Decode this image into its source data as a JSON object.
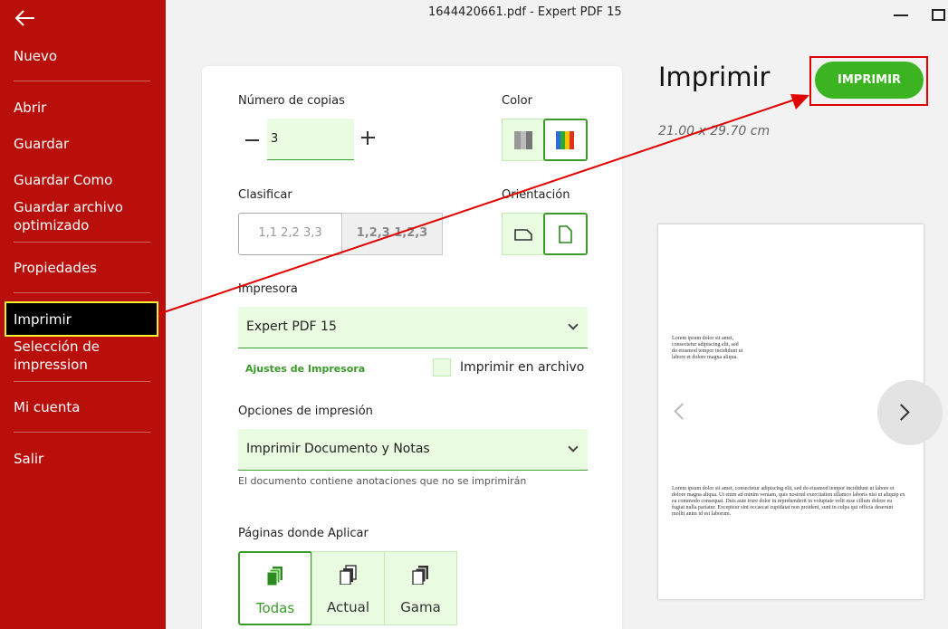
{
  "window": {
    "title": "1644420661.pdf   -   Expert PDF 15"
  },
  "sidebar": {
    "items": [
      {
        "label": "Nuevo"
      },
      {
        "label": "Abrir"
      },
      {
        "label": "Guardar"
      },
      {
        "label": "Guardar Como"
      },
      {
        "label": "Guardar archivo optimizado"
      },
      {
        "label": "Propiedades"
      },
      {
        "label": "Imprimir"
      },
      {
        "label": "Selección de impression"
      },
      {
        "label": "Mi cuenta"
      },
      {
        "label": "Salir"
      }
    ],
    "active": "Imprimir"
  },
  "print": {
    "copies_label": "Número de copias",
    "copies_value": "3",
    "color_label": "Color",
    "collate_label": "Clasificar",
    "collate_options": [
      "1,1 2,2 3,3",
      "1,2,3 1,2,3"
    ],
    "orientation_label": "Orientación",
    "printer_label": "Impresora",
    "printer_value": "Expert PDF 15",
    "printer_settings_link": "Ajustes de Impresora",
    "print_to_file_label": "Imprimir en archivo",
    "options_label": "Opciones de impresión",
    "options_value": "Imprimir Documento y Notas",
    "annotations_note": "El documento contiene anotaciones que no se imprimirán",
    "pages_label": "Páginas donde Aplicar",
    "pages_options": [
      "Todas",
      "Actual",
      "Gama"
    ]
  },
  "preview": {
    "heading": "Imprimir",
    "button_label": "IMPRIMIR",
    "page_size": "21.00 x 29.70 cm",
    "lorem_short": "Lorem ipsum dolor sit amet, consectetur adipiscing elit, sed do eiusmod tempor incididunt ut labore et dolore magna aliqua.",
    "lorem_long": "Lorem ipsum dolor sit amet, consectetur adipiscing elit, sed do eiusmod tempor incididunt ut labore et dolore magna aliqua. Ut enim ad minim veniam, quis nostrud exercitation ullamco laboris nisi ut aliquip ex ea commodo consequat. Duis aute irure dolor in reprehenderit in voluptate velit esse cillum dolore eu fugiat nulla pariatur. Excepteur sint occaecat cupidatat non proident, sunt in culpa qui officia deserunt mollit anim id est laborum."
  },
  "colors": {
    "sidebar": "#b80f0a",
    "accent": "#3cb422",
    "highlight": "#e00000"
  }
}
